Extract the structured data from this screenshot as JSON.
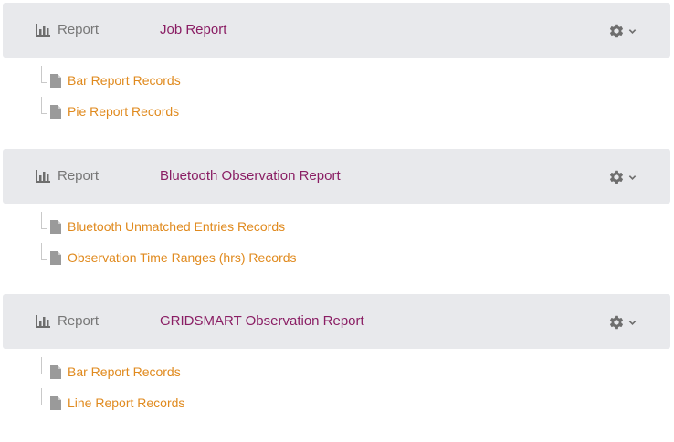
{
  "reports": [
    {
      "type_label": "Report",
      "title": "Job Report",
      "records": [
        {
          "label": "Bar Report Records"
        },
        {
          "label": "Pie Report Records"
        }
      ]
    },
    {
      "type_label": "Report",
      "title": "Bluetooth Observation Report",
      "records": [
        {
          "label": "Bluetooth Unmatched Entries Records"
        },
        {
          "label": "Observation Time Ranges (hrs) Records"
        }
      ]
    },
    {
      "type_label": "Report",
      "title": "GRIDSMART Observation Report",
      "records": [
        {
          "label": "Bar Report Records"
        },
        {
          "label": "Line Report Records"
        }
      ]
    }
  ],
  "icons": {
    "report_type": "bar-chart-icon",
    "settings": "gear-icon",
    "dropdown": "chevron-down-icon",
    "record": "document-icon"
  },
  "colors": {
    "header_bg": "#e8e9ec",
    "title": "#8a1e64",
    "record_link": "#e08a1e",
    "muted_text": "#777777",
    "icon": "#6e6e6e"
  }
}
